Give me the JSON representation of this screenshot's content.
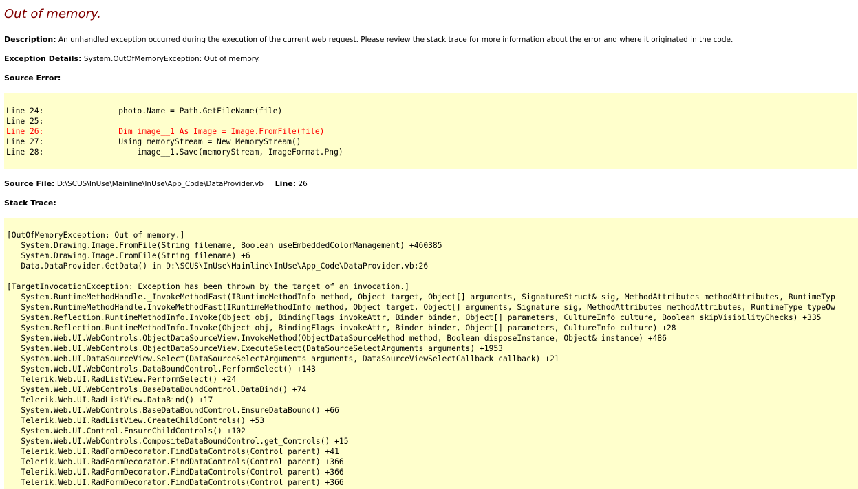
{
  "title": "Out of memory.",
  "description": {
    "label": "Description:",
    "text": "An unhandled exception occurred during the execution of the current web request. Please review the stack trace for more information about the error and where it originated in the code."
  },
  "exception_details": {
    "label": "Exception Details:",
    "text": "System.OutOfMemoryException: Out of memory."
  },
  "source_error": {
    "label": "Source Error:",
    "lines": [
      {
        "text": "Line 24:                photo.Name = Path.GetFileName(file)",
        "highlight": false
      },
      {
        "text": "Line 25:",
        "highlight": false
      },
      {
        "text": "Line 26:                Dim image__1 As Image = Image.FromFile(file)",
        "highlight": true
      },
      {
        "text": "Line 27:                Using memoryStream = New MemoryStream()",
        "highlight": false
      },
      {
        "text": "Line 28:                    image__1.Save(memoryStream, ImageFormat.Png)",
        "highlight": false
      }
    ]
  },
  "source_file": {
    "label": "Source File:",
    "path": "D:\\SCUS\\InUse\\Mainline\\InUse\\App_Code\\DataProvider.vb",
    "line_label": "Line:",
    "line_number": "26"
  },
  "stack_trace": {
    "label": "Stack Trace:",
    "lines": [
      "[OutOfMemoryException: Out of memory.]",
      "   System.Drawing.Image.FromFile(String filename, Boolean useEmbeddedColorManagement) +460385",
      "   System.Drawing.Image.FromFile(String filename) +6",
      "   Data.DataProvider.GetData() in D:\\SCUS\\InUse\\Mainline\\InUse\\App_Code\\DataProvider.vb:26",
      "",
      "[TargetInvocationException: Exception has been thrown by the target of an invocation.]",
      "   System.RuntimeMethodHandle._InvokeMethodFast(IRuntimeMethodInfo method, Object target, Object[] arguments, SignatureStruct& sig, MethodAttributes methodAttributes, RuntimeTyp",
      "   System.RuntimeMethodHandle.InvokeMethodFast(IRuntimeMethodInfo method, Object target, Object[] arguments, Signature sig, MethodAttributes methodAttributes, RuntimeType typeOw",
      "   System.Reflection.RuntimeMethodInfo.Invoke(Object obj, BindingFlags invokeAttr, Binder binder, Object[] parameters, CultureInfo culture, Boolean skipVisibilityChecks) +335",
      "   System.Reflection.RuntimeMethodInfo.Invoke(Object obj, BindingFlags invokeAttr, Binder binder, Object[] parameters, CultureInfo culture) +28",
      "   System.Web.UI.WebControls.ObjectDataSourceView.InvokeMethod(ObjectDataSourceMethod method, Boolean disposeInstance, Object& instance) +486",
      "   System.Web.UI.WebControls.ObjectDataSourceView.ExecuteSelect(DataSourceSelectArguments arguments) +1953",
      "   System.Web.UI.DataSourceView.Select(DataSourceSelectArguments arguments, DataSourceViewSelectCallback callback) +21",
      "   System.Web.UI.WebControls.DataBoundControl.PerformSelect() +143",
      "   Telerik.Web.UI.RadListView.PerformSelect() +24",
      "   System.Web.UI.WebControls.BaseDataBoundControl.DataBind() +74",
      "   Telerik.Web.UI.RadListView.DataBind() +17",
      "   System.Web.UI.WebControls.BaseDataBoundControl.EnsureDataBound() +66",
      "   Telerik.Web.UI.RadListView.CreateChildControls() +53",
      "   System.Web.UI.Control.EnsureChildControls() +102",
      "   System.Web.UI.WebControls.CompositeDataBoundControl.get_Controls() +15",
      "   Telerik.Web.UI.RadFormDecorator.FindDataControls(Control parent) +41",
      "   Telerik.Web.UI.RadFormDecorator.FindDataControls(Control parent) +366",
      "   Telerik.Web.UI.RadFormDecorator.FindDataControls(Control parent) +366",
      "   Telerik.Web.UI.RadFormDecorator.FindDataControls(Control parent) +366"
    ]
  },
  "colors": {
    "title": "#800000",
    "code_background": "#ffffcc",
    "error_line": "#ff0000"
  }
}
